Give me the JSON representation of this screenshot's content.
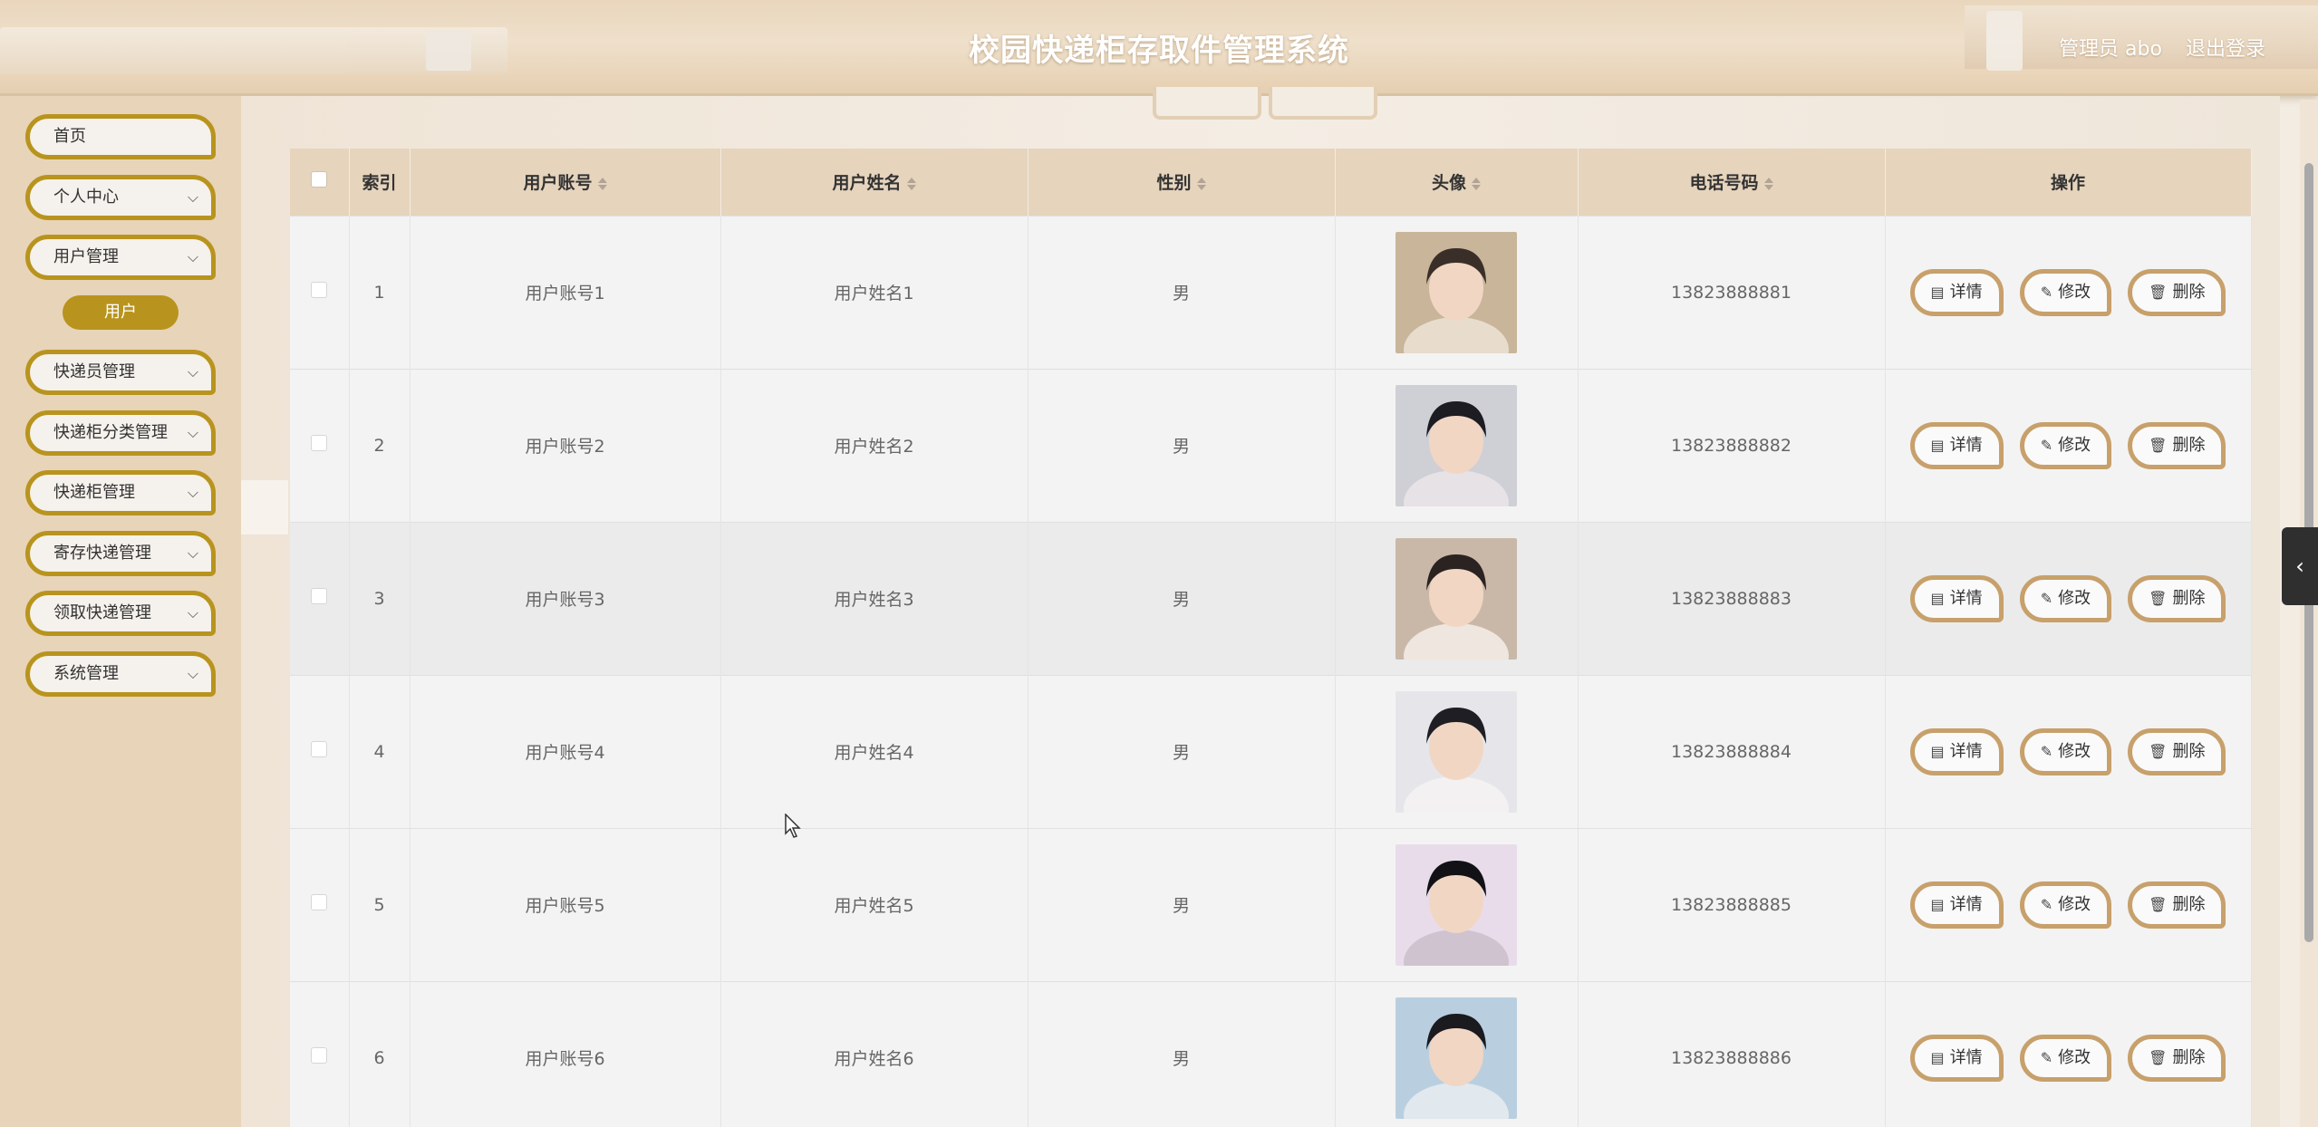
{
  "header": {
    "title": "校园快递柜存取件管理系统",
    "admin_label": "管理员 abo",
    "logout_label": "退出登录"
  },
  "sidebar": {
    "items": [
      {
        "label": "首页",
        "has_children": false
      },
      {
        "label": "个人中心",
        "has_children": true
      },
      {
        "label": "用户管理",
        "has_children": true
      },
      {
        "label": "快递员管理",
        "has_children": true
      },
      {
        "label": "快递柜分类管理",
        "has_children": true
      },
      {
        "label": "快递柜管理",
        "has_children": true
      },
      {
        "label": "寄存快递管理",
        "has_children": true
      },
      {
        "label": "领取快递管理",
        "has_children": true
      },
      {
        "label": "系统管理",
        "has_children": true
      }
    ],
    "active_submenu": "用户",
    "accent_color": "#b8941e"
  },
  "table": {
    "columns": {
      "index": "索引",
      "account": "用户账号",
      "name": "用户姓名",
      "gender": "性别",
      "avatar": "头像",
      "phone": "电话号码",
      "actions": "操作"
    },
    "rows": [
      {
        "index": "1",
        "account": "用户账号1",
        "name": "用户姓名1",
        "gender": "男",
        "phone": "13823888881"
      },
      {
        "index": "2",
        "account": "用户账号2",
        "name": "用户姓名2",
        "gender": "男",
        "phone": "13823888882"
      },
      {
        "index": "3",
        "account": "用户账号3",
        "name": "用户姓名3",
        "gender": "男",
        "phone": "13823888883"
      },
      {
        "index": "4",
        "account": "用户账号4",
        "name": "用户姓名4",
        "gender": "男",
        "phone": "13823888884"
      },
      {
        "index": "5",
        "account": "用户账号5",
        "name": "用户姓名5",
        "gender": "男",
        "phone": "13823888885"
      },
      {
        "index": "6",
        "account": "用户账号6",
        "name": "用户姓名6",
        "gender": "男",
        "phone": "13823888886"
      }
    ],
    "actions": {
      "detail": "详情",
      "edit": "修改",
      "delete": "删除"
    },
    "header_color": "#e6d4bd",
    "button_border_color": "#c7a06b"
  },
  "icons": {
    "detail": "document-icon",
    "edit": "pencil-icon",
    "delete": "trash-icon",
    "chevron": "chevron-down-icon",
    "side_toggle": "chevron-left-icon"
  }
}
